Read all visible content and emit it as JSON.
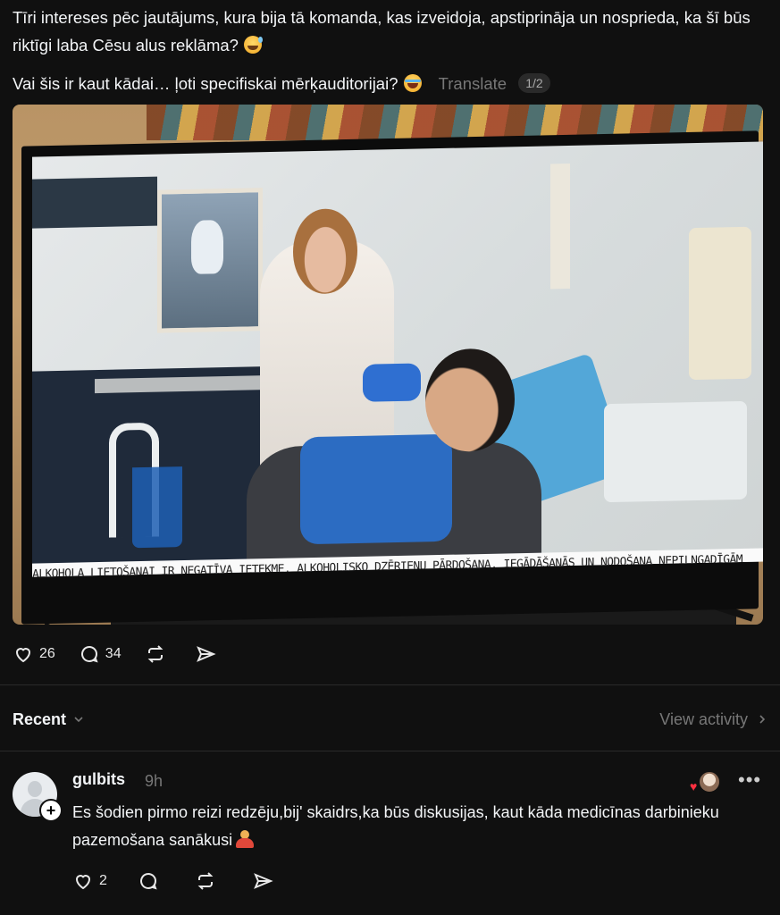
{
  "post": {
    "line1": "Tīri intereses pēc jautājums, kura bija tā komanda, kas izveidoja, apstiprināja un nosprieda, ka šī būs riktīgi laba Cēsu alus reklāma?",
    "line2": "Vai šis ir kaut kādai… ļoti specifiskai mērķauditorijai?",
    "translate_label": "Translate",
    "page_indicator": "1/2",
    "image_caption": "Alkohola lietošanai ir negatīva ietekme. Alkoholisko dzērienu pārdošana, iegādāšanās un nodošana nepilngadīgām personām ir aizliegta."
  },
  "actions": {
    "likes": "26",
    "comments": "34"
  },
  "feed": {
    "recent_label": "Recent",
    "view_activity_label": "View activity"
  },
  "comment": {
    "username": "gulbits",
    "time": "9h",
    "text": "Es šodien pirmo reizi redzēju,bij' skaidrs,ka būs diskusijas, kaut kāda medicīnas darbinieku pazemošana sanākusi",
    "likes": "2",
    "more_label": "•••"
  },
  "colors": {
    "background": "#101010",
    "text": "#f3f5f7",
    "muted": "#777777",
    "like_heart": "#ff3040"
  },
  "icons": [
    "heart-icon",
    "comment-icon",
    "repost-icon",
    "share-icon",
    "chevron-down-icon",
    "chevron-right-icon",
    "more-icon",
    "follow-plus-icon"
  ]
}
